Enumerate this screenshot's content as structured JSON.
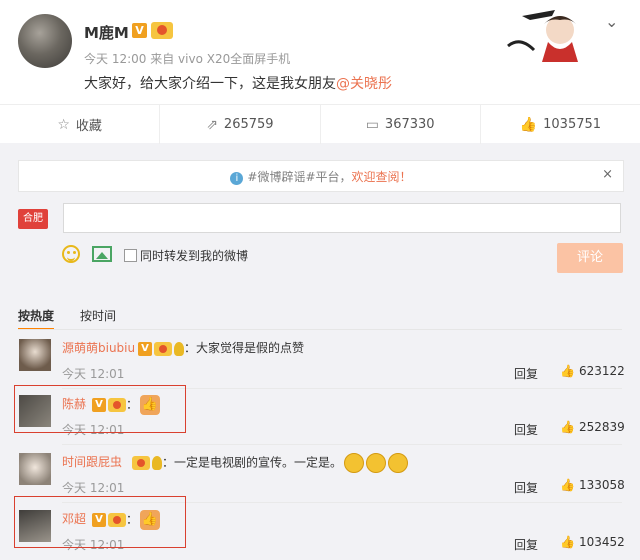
{
  "post": {
    "username": "M鹿M",
    "verified_mark": "V",
    "time": "今天 12:00",
    "source": "来自 vivo X20全面屏手机",
    "text": "大家好，给大家介绍一下，这是我女朋友",
    "mention": "@关晓彤",
    "actions": {
      "favorite_label": "收藏",
      "repost_count": "265759",
      "comment_count": "367330",
      "like_count": "1035751"
    },
    "icons": [
      "star-icon",
      "share-icon",
      "comment-icon",
      "thumb-icon",
      "chevron-down-icon"
    ]
  },
  "notice": {
    "text": "#微博辟谣#平台，",
    "welcome": "欢迎查阅！",
    "close": "×"
  },
  "composer": {
    "avatar_label": "合肥",
    "input_value": "",
    "sync_label": "同时转发到我的微博",
    "submit_label": "评论"
  },
  "sort": {
    "hot": "按热度",
    "time": "按时间"
  },
  "reply_label": "回复",
  "comments": [
    {
      "name": "源萌萌biubiu",
      "body": "：大家觉得是假的点赞",
      "time": "今天 12:01",
      "likes": "623122"
    },
    {
      "name": "陈赫",
      "body": "：",
      "time": "今天 12:01",
      "likes": "252839"
    },
    {
      "name": "时间跟屁虫",
      "body": "：一定是电视剧的宣传。一定是。",
      "time": "今天 12:01",
      "likes": "133058"
    },
    {
      "name": "邓超",
      "body": "：",
      "time": "今天 12:01",
      "likes": "103452"
    }
  ],
  "colors": {
    "accent": "#eb7350",
    "highlight": "#d9402f",
    "verified": "#f0a020"
  }
}
